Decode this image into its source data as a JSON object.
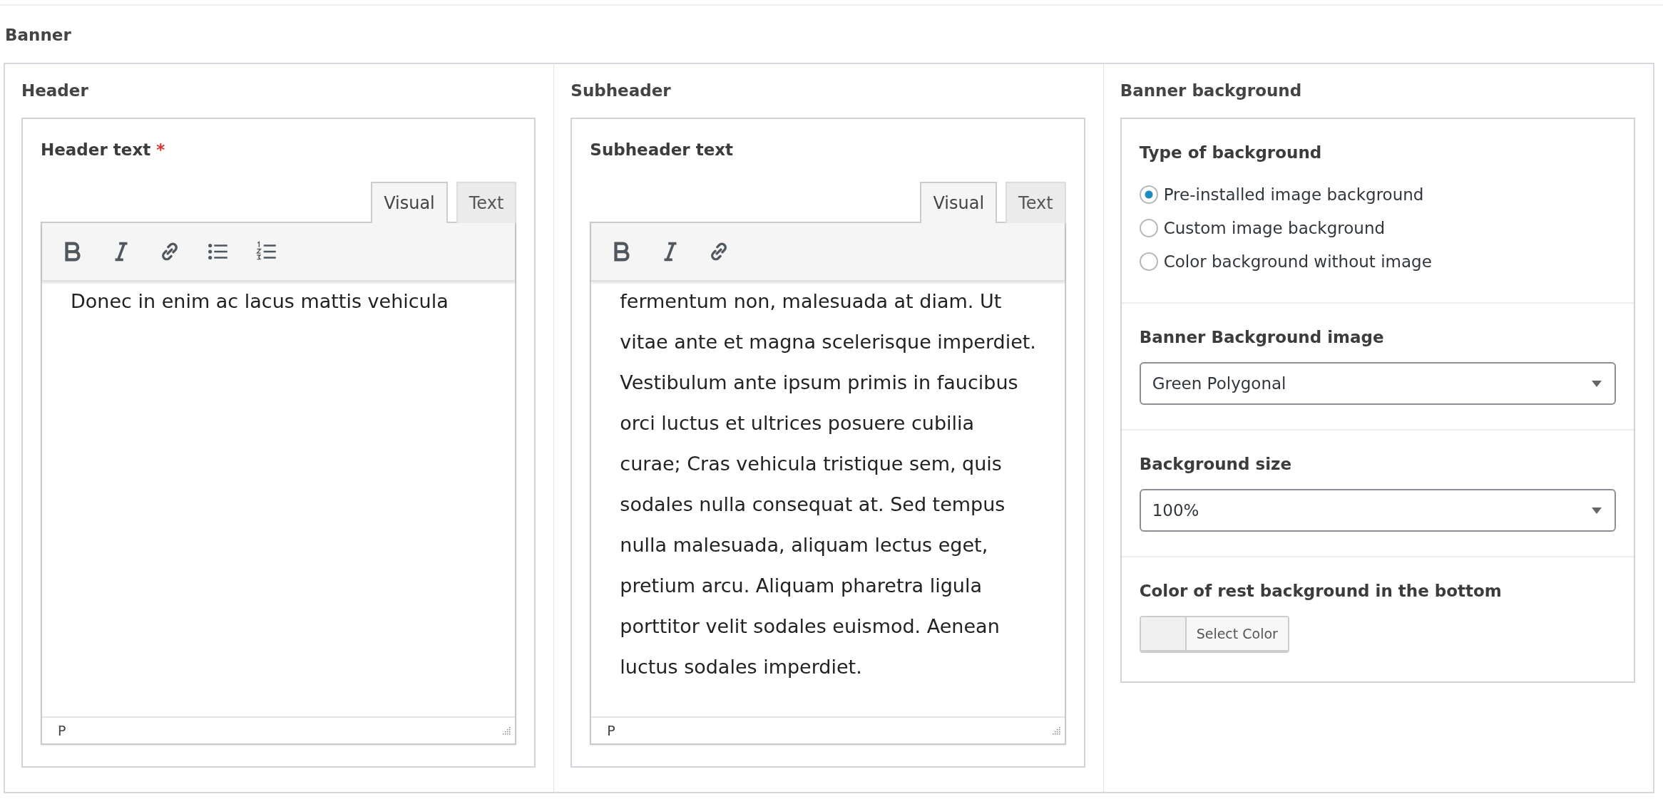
{
  "section_title": "Banner",
  "columns": [
    {
      "kind": "editor",
      "title": "Header",
      "field_label": "Header text",
      "required": true,
      "required_mark": "*",
      "tabs": [
        {
          "label": "Visual",
          "selected": true
        },
        {
          "label": "Text",
          "selected": false
        }
      ],
      "toolbar": [
        {
          "kind": "bold"
        },
        {
          "kind": "italic"
        },
        {
          "kind": "link"
        },
        {
          "kind": "bullets"
        },
        {
          "kind": "numbers"
        }
      ],
      "content": "Donec in enim ac lacus mattis vehicula",
      "path": "P"
    },
    {
      "kind": "editor",
      "title": "Subheader",
      "field_label": "Subheader text",
      "required": false,
      "tabs": [
        {
          "label": "Visual",
          "selected": true
        },
        {
          "label": "Text",
          "selected": false
        }
      ],
      "toolbar": [
        {
          "kind": "bold"
        },
        {
          "kind": "italic"
        },
        {
          "kind": "link"
        }
      ],
      "content": "fermentum non, malesuada at diam. Ut vitae ante et magna scelerisque imperdiet. Vestibulum ante ipsum primis in faucibus orci luctus et ultrices posuere cubilia curae; Cras vehicula tristique sem, quis sodales nulla consequat at. Sed tempus nulla malesuada, aliquam lectus eget, pretium arcu. Aliquam pharetra ligula porttitor velit sodales euismod. Aenean luctus sodales imperdiet.",
      "path": "P"
    },
    {
      "kind": "settings",
      "title": "Banner background",
      "groups": [
        {
          "kind": "radio",
          "label": "Type of background",
          "options": [
            {
              "label": "Pre-installed image background",
              "selected": true
            },
            {
              "label": "Custom image background",
              "selected": false
            },
            {
              "label": "Color background without image",
              "selected": false
            }
          ]
        },
        {
          "kind": "select",
          "label": "Banner Background image",
          "value": "Green Polygonal"
        },
        {
          "kind": "select",
          "label": "Background size",
          "value": "100%"
        },
        {
          "kind": "color",
          "label": "Color of rest background in the bottom",
          "button": "Select Color"
        }
      ]
    }
  ]
}
